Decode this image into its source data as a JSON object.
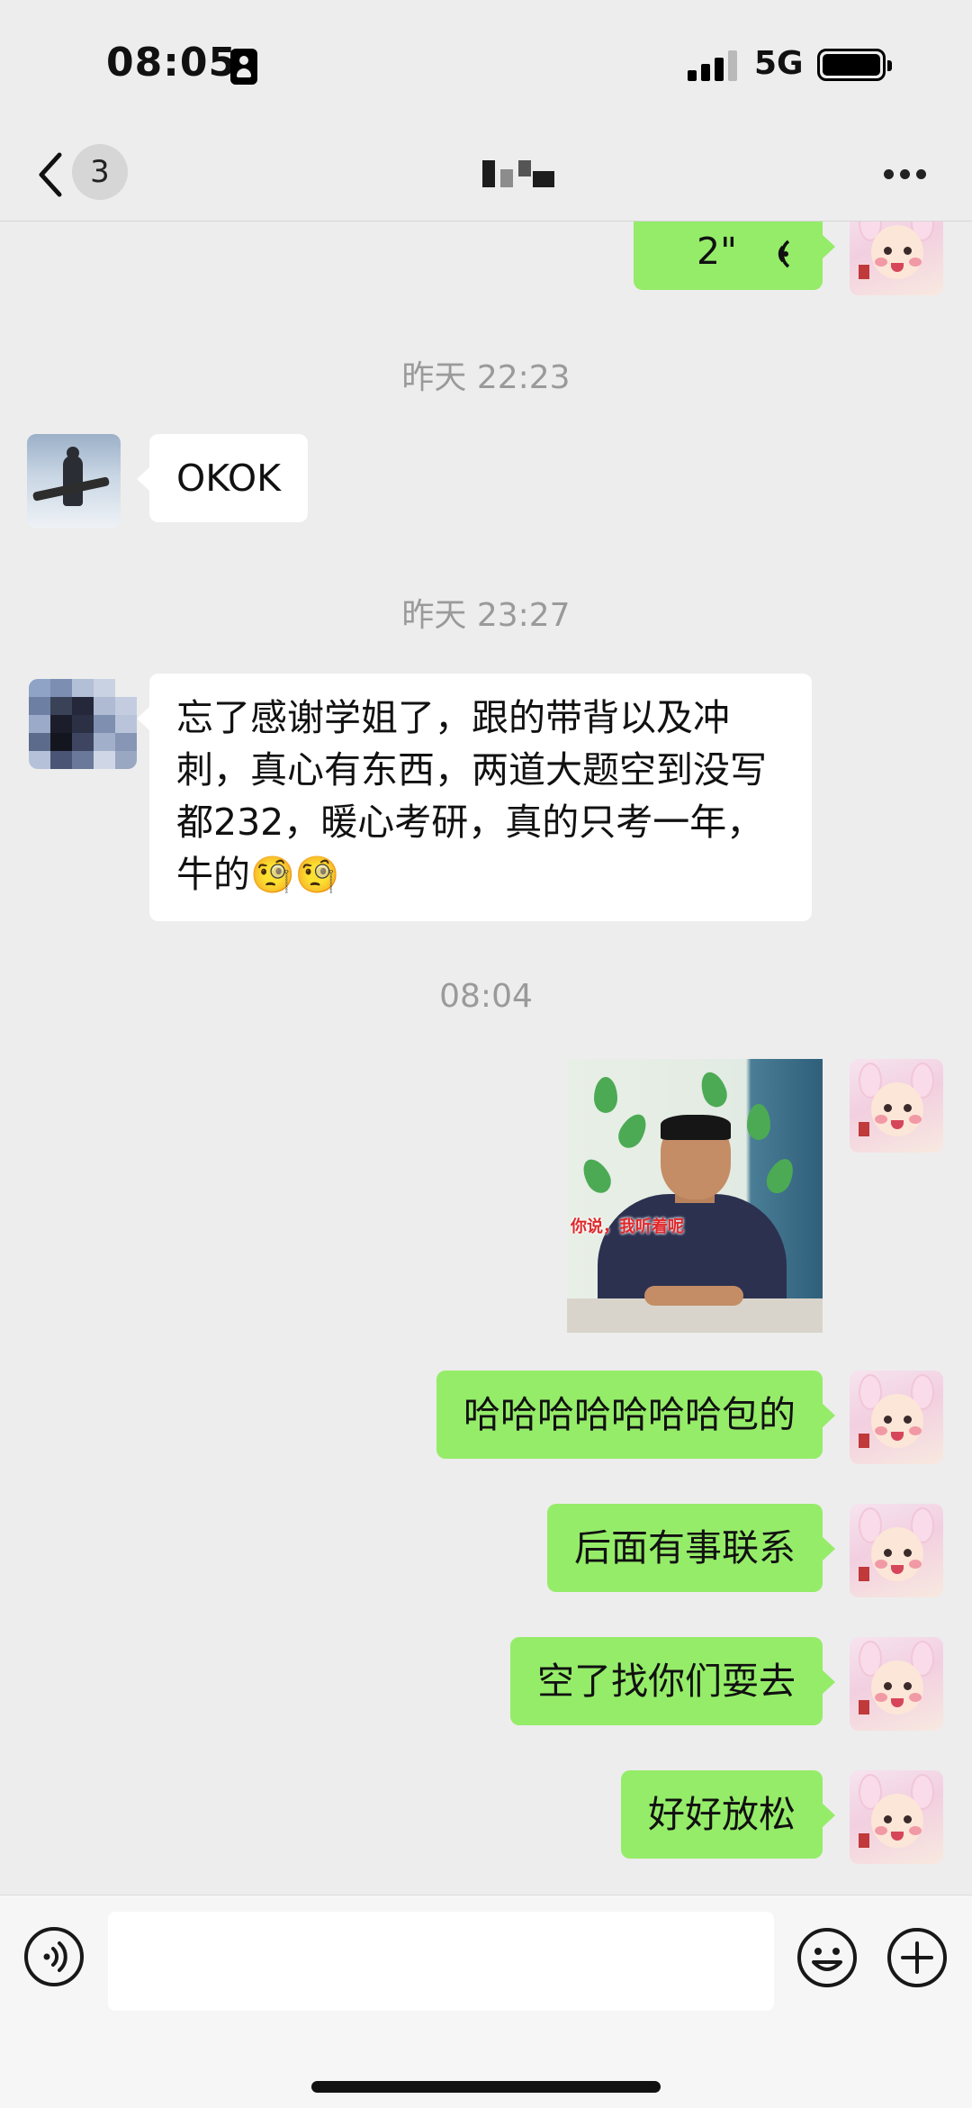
{
  "status_bar": {
    "time": "08:05",
    "network": "5G"
  },
  "nav": {
    "unread_count": "3",
    "more_icon": "more-dots-icon",
    "back_icon": "chevron-left-icon"
  },
  "messages": {
    "voice": {
      "duration": "2\""
    },
    "timestamps": [
      "昨天 22:23",
      "昨天 23:27",
      "08:04"
    ],
    "incoming": [
      {
        "text": "OKOK"
      },
      {
        "text": "忘了感谢学姐了，跟的带背以及冲刺，真心有东西，两道大题空到没写都232，暖心考研，真的只考一年，牛的",
        "emoji": "🧐🧐"
      }
    ],
    "sticker": {
      "caption": "你说，我听着呢"
    },
    "outgoing": [
      {
        "text": "哈哈哈哈哈哈哈包的"
      },
      {
        "text": "后面有事联系"
      },
      {
        "text": "空了找你们耍去"
      },
      {
        "text": "好好放松"
      }
    ]
  },
  "input_bar": {
    "input_value": "",
    "voice_icon": "voice-toggle-icon",
    "emoji_icon": "emoji-icon",
    "plus_icon": "plus-icon"
  },
  "colors": {
    "background": "#ededed",
    "outgoing_bubble": "#95ec69",
    "incoming_bubble": "#ffffff",
    "timestamp_text": "#9a9a9a"
  }
}
